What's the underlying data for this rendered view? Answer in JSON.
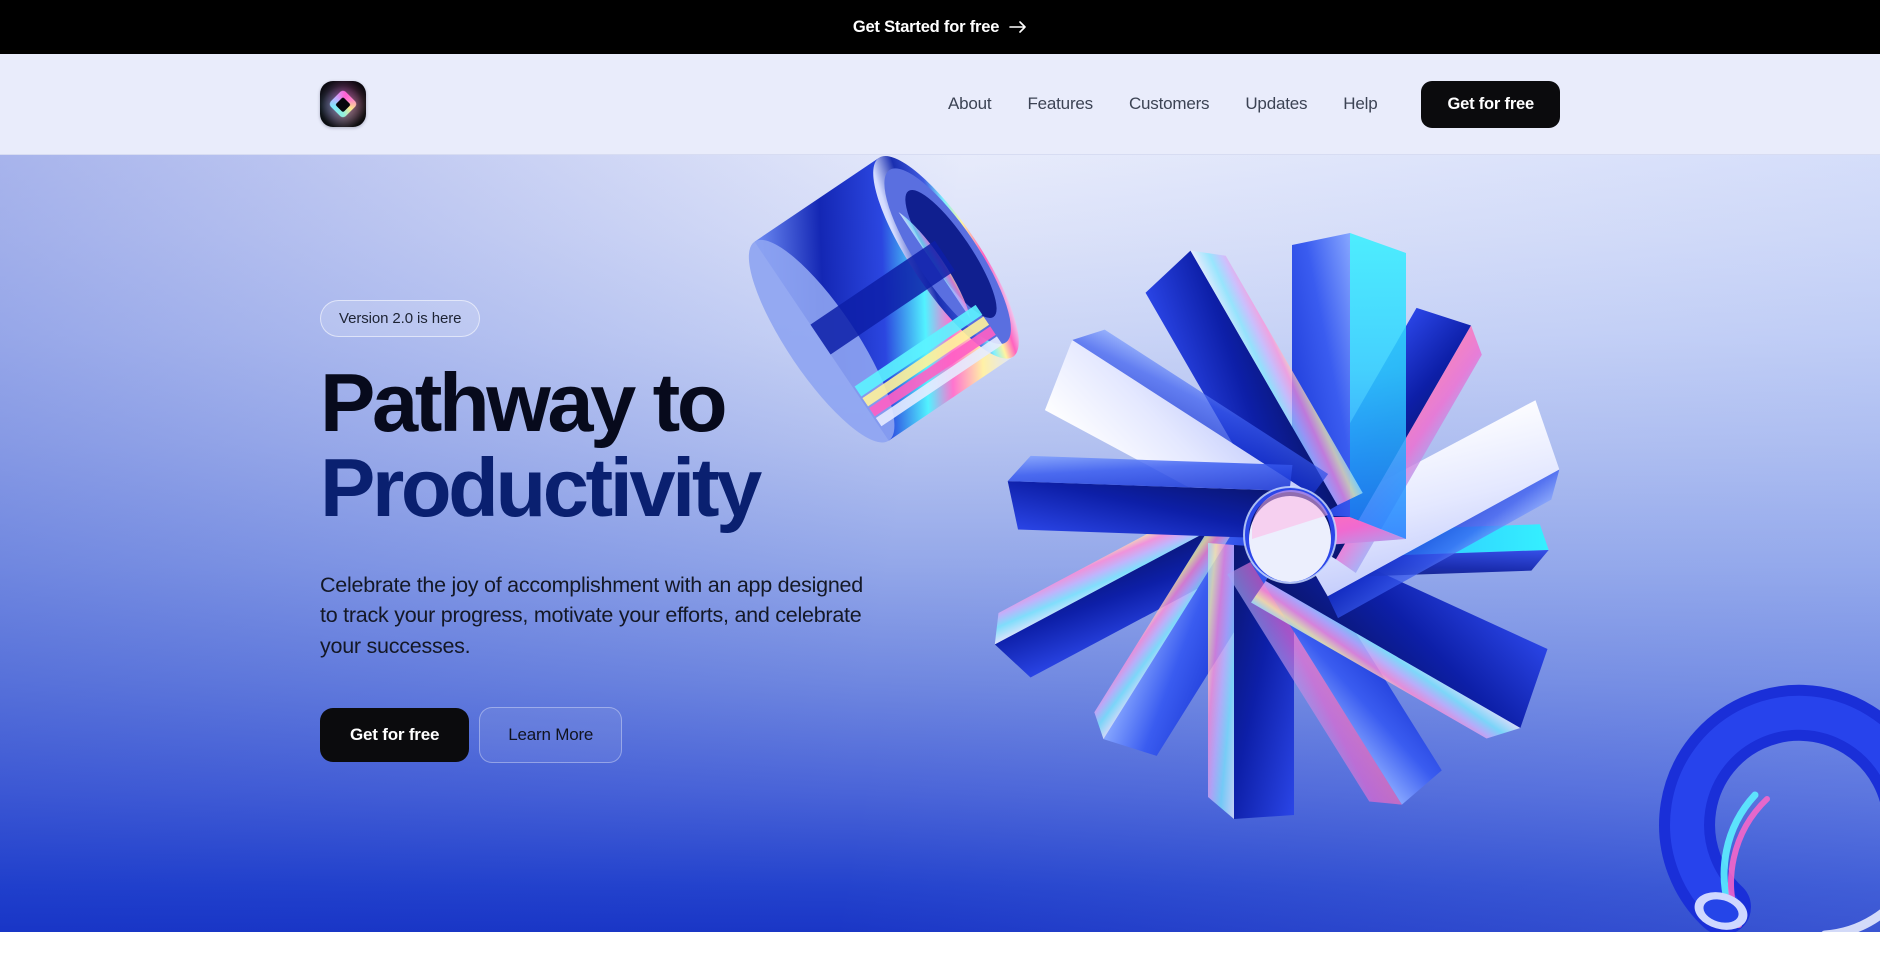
{
  "announcement": {
    "label": "Get Started for free",
    "arrow_icon": "arrow-right-icon"
  },
  "nav": {
    "logo_icon": "diamond-logo-icon",
    "links": [
      {
        "label": "About"
      },
      {
        "label": "Features"
      },
      {
        "label": "Customers"
      },
      {
        "label": "Updates"
      },
      {
        "label": "Help"
      }
    ],
    "cta_label": "Get for free"
  },
  "hero": {
    "badge_label": "Version 2.0 is here",
    "headline_line1": "Pathway to",
    "headline_line2": "Productivity",
    "subcopy": "Celebrate the joy of accomplishment with an app designed to track your progress, motivate your efforts, and celebrate your successes.",
    "primary_cta_label": "Get for free",
    "secondary_cta_label": "Learn More",
    "artwork_name": "iridescent-3d-pinwheel-illustration"
  },
  "colors": {
    "banner_bg": "#000000",
    "nav_bg": "#e9ecfb",
    "button_dark": "#0b0b0d",
    "headline_primary": "#070a1c",
    "headline_accent": "#0a2070",
    "hero_gradient_top": "#e7ebfb",
    "hero_gradient_bottom": "#1a36c6",
    "page_bg": "#ffffff"
  }
}
